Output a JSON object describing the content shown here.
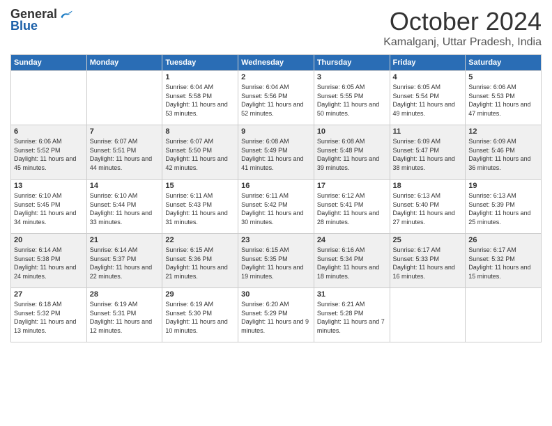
{
  "logo": {
    "general": "General",
    "blue": "Blue"
  },
  "header": {
    "month": "October 2024",
    "location": "Kamalganj, Uttar Pradesh, India"
  },
  "weekdays": [
    "Sunday",
    "Monday",
    "Tuesday",
    "Wednesday",
    "Thursday",
    "Friday",
    "Saturday"
  ],
  "weeks": [
    [
      {
        "day": null
      },
      {
        "day": null
      },
      {
        "day": 1,
        "sunrise": "Sunrise: 6:04 AM",
        "sunset": "Sunset: 5:58 PM",
        "daylight": "Daylight: 11 hours and 53 minutes."
      },
      {
        "day": 2,
        "sunrise": "Sunrise: 6:04 AM",
        "sunset": "Sunset: 5:56 PM",
        "daylight": "Daylight: 11 hours and 52 minutes."
      },
      {
        "day": 3,
        "sunrise": "Sunrise: 6:05 AM",
        "sunset": "Sunset: 5:55 PM",
        "daylight": "Daylight: 11 hours and 50 minutes."
      },
      {
        "day": 4,
        "sunrise": "Sunrise: 6:05 AM",
        "sunset": "Sunset: 5:54 PM",
        "daylight": "Daylight: 11 hours and 49 minutes."
      },
      {
        "day": 5,
        "sunrise": "Sunrise: 6:06 AM",
        "sunset": "Sunset: 5:53 PM",
        "daylight": "Daylight: 11 hours and 47 minutes."
      }
    ],
    [
      {
        "day": 6,
        "sunrise": "Sunrise: 6:06 AM",
        "sunset": "Sunset: 5:52 PM",
        "daylight": "Daylight: 11 hours and 45 minutes."
      },
      {
        "day": 7,
        "sunrise": "Sunrise: 6:07 AM",
        "sunset": "Sunset: 5:51 PM",
        "daylight": "Daylight: 11 hours and 44 minutes."
      },
      {
        "day": 8,
        "sunrise": "Sunrise: 6:07 AM",
        "sunset": "Sunset: 5:50 PM",
        "daylight": "Daylight: 11 hours and 42 minutes."
      },
      {
        "day": 9,
        "sunrise": "Sunrise: 6:08 AM",
        "sunset": "Sunset: 5:49 PM",
        "daylight": "Daylight: 11 hours and 41 minutes."
      },
      {
        "day": 10,
        "sunrise": "Sunrise: 6:08 AM",
        "sunset": "Sunset: 5:48 PM",
        "daylight": "Daylight: 11 hours and 39 minutes."
      },
      {
        "day": 11,
        "sunrise": "Sunrise: 6:09 AM",
        "sunset": "Sunset: 5:47 PM",
        "daylight": "Daylight: 11 hours and 38 minutes."
      },
      {
        "day": 12,
        "sunrise": "Sunrise: 6:09 AM",
        "sunset": "Sunset: 5:46 PM",
        "daylight": "Daylight: 11 hours and 36 minutes."
      }
    ],
    [
      {
        "day": 13,
        "sunrise": "Sunrise: 6:10 AM",
        "sunset": "Sunset: 5:45 PM",
        "daylight": "Daylight: 11 hours and 34 minutes."
      },
      {
        "day": 14,
        "sunrise": "Sunrise: 6:10 AM",
        "sunset": "Sunset: 5:44 PM",
        "daylight": "Daylight: 11 hours and 33 minutes."
      },
      {
        "day": 15,
        "sunrise": "Sunrise: 6:11 AM",
        "sunset": "Sunset: 5:43 PM",
        "daylight": "Daylight: 11 hours and 31 minutes."
      },
      {
        "day": 16,
        "sunrise": "Sunrise: 6:11 AM",
        "sunset": "Sunset: 5:42 PM",
        "daylight": "Daylight: 11 hours and 30 minutes."
      },
      {
        "day": 17,
        "sunrise": "Sunrise: 6:12 AM",
        "sunset": "Sunset: 5:41 PM",
        "daylight": "Daylight: 11 hours and 28 minutes."
      },
      {
        "day": 18,
        "sunrise": "Sunrise: 6:13 AM",
        "sunset": "Sunset: 5:40 PM",
        "daylight": "Daylight: 11 hours and 27 minutes."
      },
      {
        "day": 19,
        "sunrise": "Sunrise: 6:13 AM",
        "sunset": "Sunset: 5:39 PM",
        "daylight": "Daylight: 11 hours and 25 minutes."
      }
    ],
    [
      {
        "day": 20,
        "sunrise": "Sunrise: 6:14 AM",
        "sunset": "Sunset: 5:38 PM",
        "daylight": "Daylight: 11 hours and 24 minutes."
      },
      {
        "day": 21,
        "sunrise": "Sunrise: 6:14 AM",
        "sunset": "Sunset: 5:37 PM",
        "daylight": "Daylight: 11 hours and 22 minutes."
      },
      {
        "day": 22,
        "sunrise": "Sunrise: 6:15 AM",
        "sunset": "Sunset: 5:36 PM",
        "daylight": "Daylight: 11 hours and 21 minutes."
      },
      {
        "day": 23,
        "sunrise": "Sunrise: 6:15 AM",
        "sunset": "Sunset: 5:35 PM",
        "daylight": "Daylight: 11 hours and 19 minutes."
      },
      {
        "day": 24,
        "sunrise": "Sunrise: 6:16 AM",
        "sunset": "Sunset: 5:34 PM",
        "daylight": "Daylight: 11 hours and 18 minutes."
      },
      {
        "day": 25,
        "sunrise": "Sunrise: 6:17 AM",
        "sunset": "Sunset: 5:33 PM",
        "daylight": "Daylight: 11 hours and 16 minutes."
      },
      {
        "day": 26,
        "sunrise": "Sunrise: 6:17 AM",
        "sunset": "Sunset: 5:32 PM",
        "daylight": "Daylight: 11 hours and 15 minutes."
      }
    ],
    [
      {
        "day": 27,
        "sunrise": "Sunrise: 6:18 AM",
        "sunset": "Sunset: 5:32 PM",
        "daylight": "Daylight: 11 hours and 13 minutes."
      },
      {
        "day": 28,
        "sunrise": "Sunrise: 6:19 AM",
        "sunset": "Sunset: 5:31 PM",
        "daylight": "Daylight: 11 hours and 12 minutes."
      },
      {
        "day": 29,
        "sunrise": "Sunrise: 6:19 AM",
        "sunset": "Sunset: 5:30 PM",
        "daylight": "Daylight: 11 hours and 10 minutes."
      },
      {
        "day": 30,
        "sunrise": "Sunrise: 6:20 AM",
        "sunset": "Sunset: 5:29 PM",
        "daylight": "Daylight: 11 hours and 9 minutes."
      },
      {
        "day": 31,
        "sunrise": "Sunrise: 6:21 AM",
        "sunset": "Sunset: 5:28 PM",
        "daylight": "Daylight: 11 hours and 7 minutes."
      },
      {
        "day": null
      },
      {
        "day": null
      }
    ]
  ]
}
